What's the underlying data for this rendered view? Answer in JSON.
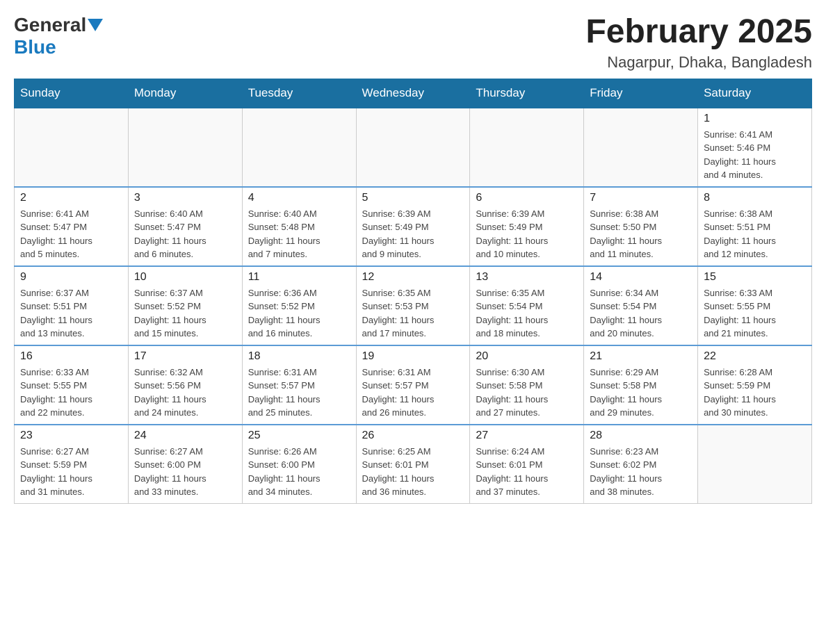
{
  "header": {
    "logo_general": "General",
    "logo_blue": "Blue",
    "month_title": "February 2025",
    "location": "Nagarpur, Dhaka, Bangladesh"
  },
  "days_of_week": [
    "Sunday",
    "Monday",
    "Tuesday",
    "Wednesday",
    "Thursday",
    "Friday",
    "Saturday"
  ],
  "weeks": [
    [
      {
        "day": "",
        "info": ""
      },
      {
        "day": "",
        "info": ""
      },
      {
        "day": "",
        "info": ""
      },
      {
        "day": "",
        "info": ""
      },
      {
        "day": "",
        "info": ""
      },
      {
        "day": "",
        "info": ""
      },
      {
        "day": "1",
        "info": "Sunrise: 6:41 AM\nSunset: 5:46 PM\nDaylight: 11 hours\nand 4 minutes."
      }
    ],
    [
      {
        "day": "2",
        "info": "Sunrise: 6:41 AM\nSunset: 5:47 PM\nDaylight: 11 hours\nand 5 minutes."
      },
      {
        "day": "3",
        "info": "Sunrise: 6:40 AM\nSunset: 5:47 PM\nDaylight: 11 hours\nand 6 minutes."
      },
      {
        "day": "4",
        "info": "Sunrise: 6:40 AM\nSunset: 5:48 PM\nDaylight: 11 hours\nand 7 minutes."
      },
      {
        "day": "5",
        "info": "Sunrise: 6:39 AM\nSunset: 5:49 PM\nDaylight: 11 hours\nand 9 minutes."
      },
      {
        "day": "6",
        "info": "Sunrise: 6:39 AM\nSunset: 5:49 PM\nDaylight: 11 hours\nand 10 minutes."
      },
      {
        "day": "7",
        "info": "Sunrise: 6:38 AM\nSunset: 5:50 PM\nDaylight: 11 hours\nand 11 minutes."
      },
      {
        "day": "8",
        "info": "Sunrise: 6:38 AM\nSunset: 5:51 PM\nDaylight: 11 hours\nand 12 minutes."
      }
    ],
    [
      {
        "day": "9",
        "info": "Sunrise: 6:37 AM\nSunset: 5:51 PM\nDaylight: 11 hours\nand 13 minutes."
      },
      {
        "day": "10",
        "info": "Sunrise: 6:37 AM\nSunset: 5:52 PM\nDaylight: 11 hours\nand 15 minutes."
      },
      {
        "day": "11",
        "info": "Sunrise: 6:36 AM\nSunset: 5:52 PM\nDaylight: 11 hours\nand 16 minutes."
      },
      {
        "day": "12",
        "info": "Sunrise: 6:35 AM\nSunset: 5:53 PM\nDaylight: 11 hours\nand 17 minutes."
      },
      {
        "day": "13",
        "info": "Sunrise: 6:35 AM\nSunset: 5:54 PM\nDaylight: 11 hours\nand 18 minutes."
      },
      {
        "day": "14",
        "info": "Sunrise: 6:34 AM\nSunset: 5:54 PM\nDaylight: 11 hours\nand 20 minutes."
      },
      {
        "day": "15",
        "info": "Sunrise: 6:33 AM\nSunset: 5:55 PM\nDaylight: 11 hours\nand 21 minutes."
      }
    ],
    [
      {
        "day": "16",
        "info": "Sunrise: 6:33 AM\nSunset: 5:55 PM\nDaylight: 11 hours\nand 22 minutes."
      },
      {
        "day": "17",
        "info": "Sunrise: 6:32 AM\nSunset: 5:56 PM\nDaylight: 11 hours\nand 24 minutes."
      },
      {
        "day": "18",
        "info": "Sunrise: 6:31 AM\nSunset: 5:57 PM\nDaylight: 11 hours\nand 25 minutes."
      },
      {
        "day": "19",
        "info": "Sunrise: 6:31 AM\nSunset: 5:57 PM\nDaylight: 11 hours\nand 26 minutes."
      },
      {
        "day": "20",
        "info": "Sunrise: 6:30 AM\nSunset: 5:58 PM\nDaylight: 11 hours\nand 27 minutes."
      },
      {
        "day": "21",
        "info": "Sunrise: 6:29 AM\nSunset: 5:58 PM\nDaylight: 11 hours\nand 29 minutes."
      },
      {
        "day": "22",
        "info": "Sunrise: 6:28 AM\nSunset: 5:59 PM\nDaylight: 11 hours\nand 30 minutes."
      }
    ],
    [
      {
        "day": "23",
        "info": "Sunrise: 6:27 AM\nSunset: 5:59 PM\nDaylight: 11 hours\nand 31 minutes."
      },
      {
        "day": "24",
        "info": "Sunrise: 6:27 AM\nSunset: 6:00 PM\nDaylight: 11 hours\nand 33 minutes."
      },
      {
        "day": "25",
        "info": "Sunrise: 6:26 AM\nSunset: 6:00 PM\nDaylight: 11 hours\nand 34 minutes."
      },
      {
        "day": "26",
        "info": "Sunrise: 6:25 AM\nSunset: 6:01 PM\nDaylight: 11 hours\nand 36 minutes."
      },
      {
        "day": "27",
        "info": "Sunrise: 6:24 AM\nSunset: 6:01 PM\nDaylight: 11 hours\nand 37 minutes."
      },
      {
        "day": "28",
        "info": "Sunrise: 6:23 AM\nSunset: 6:02 PM\nDaylight: 11 hours\nand 38 minutes."
      },
      {
        "day": "",
        "info": ""
      }
    ]
  ]
}
